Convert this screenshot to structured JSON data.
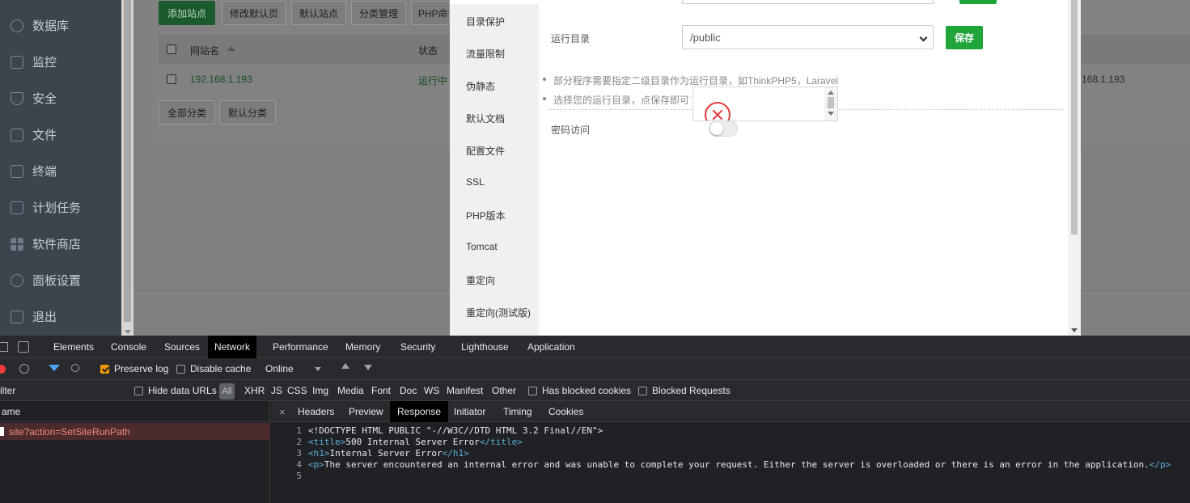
{
  "sidebar": {
    "items": [
      {
        "label": "数据库",
        "icon": "database-icon"
      },
      {
        "label": "监控",
        "icon": "monitor-icon"
      },
      {
        "label": "安全",
        "icon": "shield-icon"
      },
      {
        "label": "文件",
        "icon": "folder-icon"
      },
      {
        "label": "终端",
        "icon": "terminal-icon"
      },
      {
        "label": "计划任务",
        "icon": "calendar-icon"
      },
      {
        "label": "软件商店",
        "icon": "grid-icon"
      },
      {
        "label": "面板设置",
        "icon": "gear-icon"
      },
      {
        "label": "退出",
        "icon": "logout-icon"
      }
    ]
  },
  "site_toolbar": {
    "add_site": "添加站点",
    "edit_default_page": "修改默认页",
    "default_site": "默认站点",
    "category_manage": "分类管理",
    "php_cmd": "PHP命令"
  },
  "site_table": {
    "headers": {
      "site_name": "网站名",
      "status": "状态"
    },
    "rows": [
      {
        "site_name": "192.168.1.193",
        "status": "运行中",
        "extra": "168.1.193"
      }
    ]
  },
  "category_buttons": {
    "all": "全部分类",
    "default": "默认分类"
  },
  "modal": {
    "menu": [
      "目录保护",
      "流量限制",
      "伪静态",
      "默认文档",
      "配置文件",
      "SSL",
      "PHP版本",
      "Tomcat",
      "重定向",
      "重定向(测试版)"
    ],
    "run_dir_label": "运行目录",
    "run_dir_value": "/public",
    "save_label": "保存",
    "tips": [
      "部分程序需要指定二级目录作为运行目录，如ThinkPHP5，Laravel",
      "选择您的运行目录，点保存即可"
    ],
    "password_access_label": "密码访问"
  },
  "devtools": {
    "tabs": [
      "Elements",
      "Console",
      "Sources",
      "Network",
      "Performance",
      "Memory",
      "Security",
      "Lighthouse",
      "Application"
    ],
    "active_tab": "Network",
    "toolbar": {
      "preserve_log": "Preserve log",
      "disable_cache": "Disable cache",
      "throttle": "Online"
    },
    "filter": {
      "placeholder": "ilter",
      "hide_data_urls": "Hide data URLs",
      "all": "All",
      "types": [
        "XHR",
        "JS",
        "CSS",
        "Img",
        "Media",
        "Font",
        "Doc",
        "WS",
        "Manifest",
        "Other"
      ],
      "has_blocked_cookies": "Has blocked cookies",
      "blocked_requests": "Blocked Requests"
    },
    "name_header": "ame",
    "request": "site?action=SetSiteRunPath",
    "detail_tabs": [
      "Headers",
      "Preview",
      "Response",
      "Initiator",
      "Timing",
      "Cookies"
    ],
    "active_detail_tab": "Response",
    "response_lines": [
      {
        "n": "1",
        "pre": "",
        "tag1": "",
        "text": "<!DOCTYPE HTML PUBLIC \"-//W3C//DTD HTML 3.2 Final//EN\">",
        "tag2": ""
      },
      {
        "n": "2",
        "tag1": "<title>",
        "text": "500 Internal Server Error",
        "tag2": "</title>"
      },
      {
        "n": "3",
        "tag1": "<h1>",
        "text": "Internal Server Error",
        "tag2": "</h1>"
      },
      {
        "n": "4",
        "tag1": "<p>",
        "text": "The server encountered an internal error and was unable to complete your request. Either the server is overloaded or there is an error in the application.",
        "tag2": "</p>"
      },
      {
        "n": "5",
        "tag1": "",
        "text": "",
        "tag2": ""
      }
    ]
  }
}
